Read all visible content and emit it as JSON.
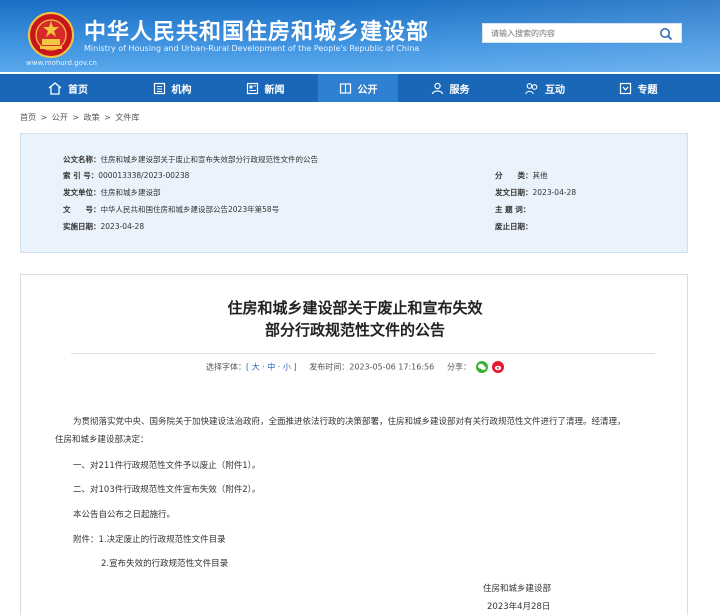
{
  "header": {
    "title": "中华人民共和国住房和城乡建设部",
    "subtitle": "Ministry of Housing and Urban-Rural Development of the People's Republic of China",
    "url": "www.mohurd.gov.cn",
    "search_placeholder": "请输入搜索的内容"
  },
  "nav": {
    "items": [
      {
        "label": "首页",
        "icon": "home-icon"
      },
      {
        "label": "机构",
        "icon": "building-icon"
      },
      {
        "label": "新闻",
        "icon": "news-icon"
      },
      {
        "label": "公开",
        "icon": "open-icon"
      },
      {
        "label": "服务",
        "icon": "user-service-icon"
      },
      {
        "label": "互动",
        "icon": "interact-icon"
      },
      {
        "label": "专题",
        "icon": "topic-icon"
      }
    ]
  },
  "breadcrumb": [
    "首页",
    ">",
    "公开",
    ">",
    "政策",
    ">",
    "文件库"
  ],
  "meta": {
    "doc_name_label": "公文名称：",
    "doc_name": "住房和城乡建设部关于废止和宣布失效部分行政规范性文件的公告",
    "index_label": "索 引 号：",
    "index": "000013338/2023-00238",
    "category_label": "分　　类：",
    "category": "其他",
    "issuer_label": "发文单位：",
    "issuer": "住房和城乡建设部",
    "issue_date_label": "发文日期：",
    "issue_date": "2023-04-28",
    "doc_no_label": "文　　号：",
    "doc_no": "中华人民共和国住房和城乡建设部公告2023年第58号",
    "topic_label": "主 题 词：",
    "topic": "",
    "effective_label": "实施日期：",
    "effective": "2023-04-28",
    "abolish_label": "废止日期：",
    "abolish": ""
  },
  "article": {
    "title_line1": "住房和城乡建设部关于废止和宣布失效",
    "title_line2": "部分行政规范性文件的公告",
    "font_label": "选择字体：",
    "font_sizes": "[ 大 · 中 · 小 ]",
    "publish_label": "发布时间：",
    "publish_time": "2023-05-06 17:16:56",
    "share_label": "分享：",
    "para1_line1": "为贯彻落实党中央、国务院关于加快建设法治政府，全面推进依法行政的决策部署，住房和城乡建设部对有关行政规范性文件进行了清理。经清理，",
    "para1_line2": "住房和城乡建设部决定：",
    "item1": "一、对211件行政规范性文件予以废止（附件1）。",
    "item2": "二、对103件行政规范性文件宣布失效（附件2）。",
    "effective_note": "本公告自公布之日起施行。",
    "attachment1": "附件：1.决定废止的行政规范性文件目录",
    "attachment2": "2.宣布失效的行政规范性文件目录",
    "signature": "住房和城乡建设部",
    "sign_date": "2023年4月28日"
  },
  "colors": {
    "header_blue": "#1b6fc4",
    "nav_blue": "#1a67b8",
    "meta_bg": "#eaf3fb",
    "link_blue": "#2a66b3"
  }
}
